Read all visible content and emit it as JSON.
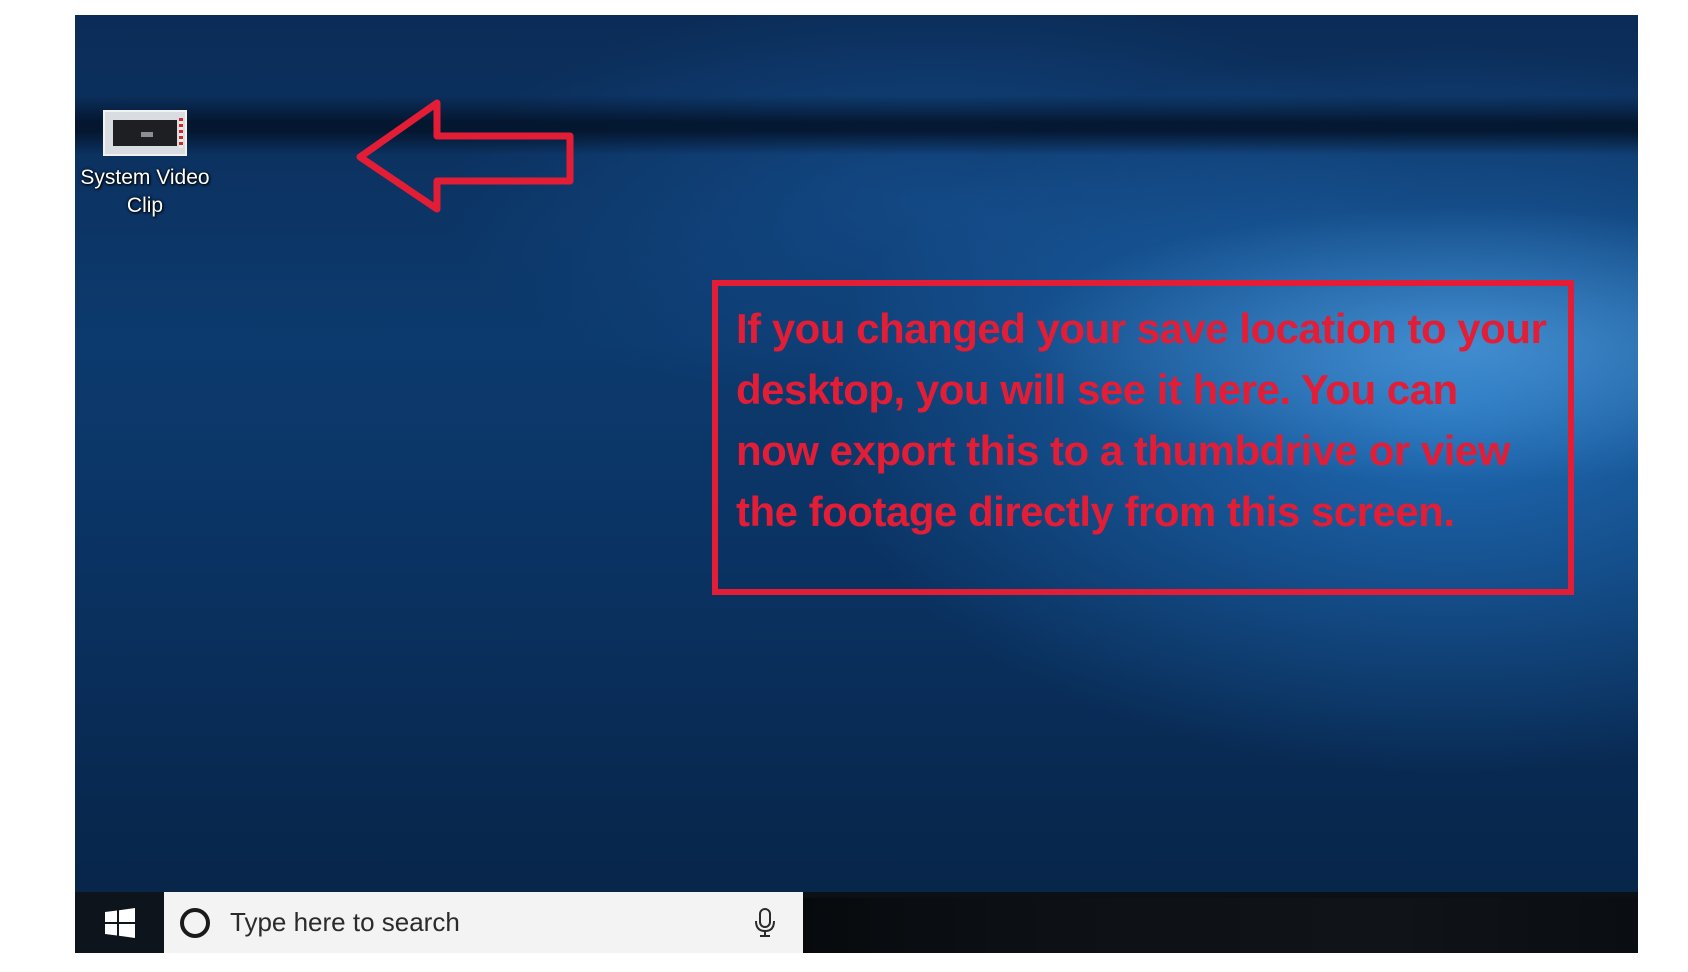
{
  "desktop": {
    "icons": [
      {
        "label_line1": "System Video",
        "label_line2": "Clip",
        "icon": "video-file-thumbnail-icon"
      }
    ]
  },
  "annotation": {
    "arrow_icon": "red-outline-left-arrow",
    "callout_text": "If you changed your save location to your desktop, you will see it here. You can now export this to a thumbdrive or view the footage directly from this screen.",
    "color": "#e31d36"
  },
  "taskbar": {
    "start_icon": "windows-logo-icon",
    "search": {
      "placeholder": "Type here to search",
      "search_icon": "cortana-ring-icon",
      "mic_icon": "microphone-icon"
    }
  },
  "colors": {
    "wallpaper_dark": "#08284f",
    "wallpaper_light": "#1f7fd0",
    "taskbar": "#0b1016",
    "search_bg": "#f3f3f3"
  }
}
